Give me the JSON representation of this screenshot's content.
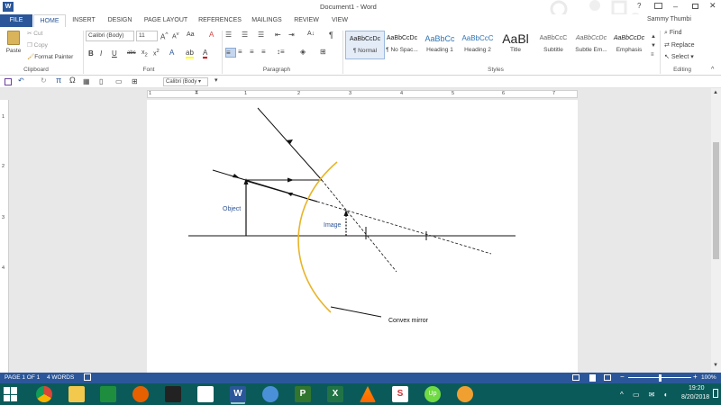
{
  "window": {
    "title": "Document1 - Word",
    "user": "Sammy Thumbi"
  },
  "tabs": [
    "FILE",
    "HOME",
    "INSERT",
    "DESIGN",
    "PAGE LAYOUT",
    "REFERENCES",
    "MAILINGS",
    "REVIEW",
    "VIEW"
  ],
  "clipboard": {
    "paste": "Paste",
    "cut": "Cut",
    "copy": "Copy",
    "format_painter": "Format Painter",
    "label": "Clipboard"
  },
  "font": {
    "name": "Calibri (Body)",
    "size": "11",
    "label": "Font"
  },
  "paragraph": {
    "label": "Paragraph"
  },
  "styles": {
    "label": "Styles",
    "items": [
      {
        "preview": "AaBbCcDc",
        "name": "¶ Normal"
      },
      {
        "preview": "AaBbCcDc",
        "name": "¶ No Spac..."
      },
      {
        "preview": "AaBbCc",
        "name": "Heading 1"
      },
      {
        "preview": "AaBbCcC",
        "name": "Heading 2"
      },
      {
        "preview": "AaBl",
        "name": "Title"
      },
      {
        "preview": "AaBbCcC",
        "name": "Subtitle"
      },
      {
        "preview": "AaBbCcDc",
        "name": "Subtle Em..."
      },
      {
        "preview": "AaBbCcDc",
        "name": "Emphasis"
      }
    ]
  },
  "editing": {
    "find": "Find",
    "replace": "Replace",
    "select": "Select",
    "label": "Editing"
  },
  "qat": {
    "font_name": "Calibri (Body"
  },
  "ruler": {
    "numbers": [
      "1",
      "1",
      "2",
      "3",
      "4",
      "5",
      "6",
      "7"
    ],
    "vnumbers": [
      "1",
      "2",
      "3",
      "4"
    ]
  },
  "diagram": {
    "object_label": "Object",
    "image_label": "Image",
    "mirror_label": "Convex mirror"
  },
  "status": {
    "page": "PAGE 1 OF 1",
    "words": "4 WORDS",
    "zoom": "100%"
  },
  "clock": {
    "time": "19:20",
    "date": "8/20/2018"
  },
  "colors": {
    "accent": "#2b579a",
    "mirror": "#e8b428",
    "diagram_text": "#2e5597",
    "taskbar": "#0b5a5a"
  }
}
